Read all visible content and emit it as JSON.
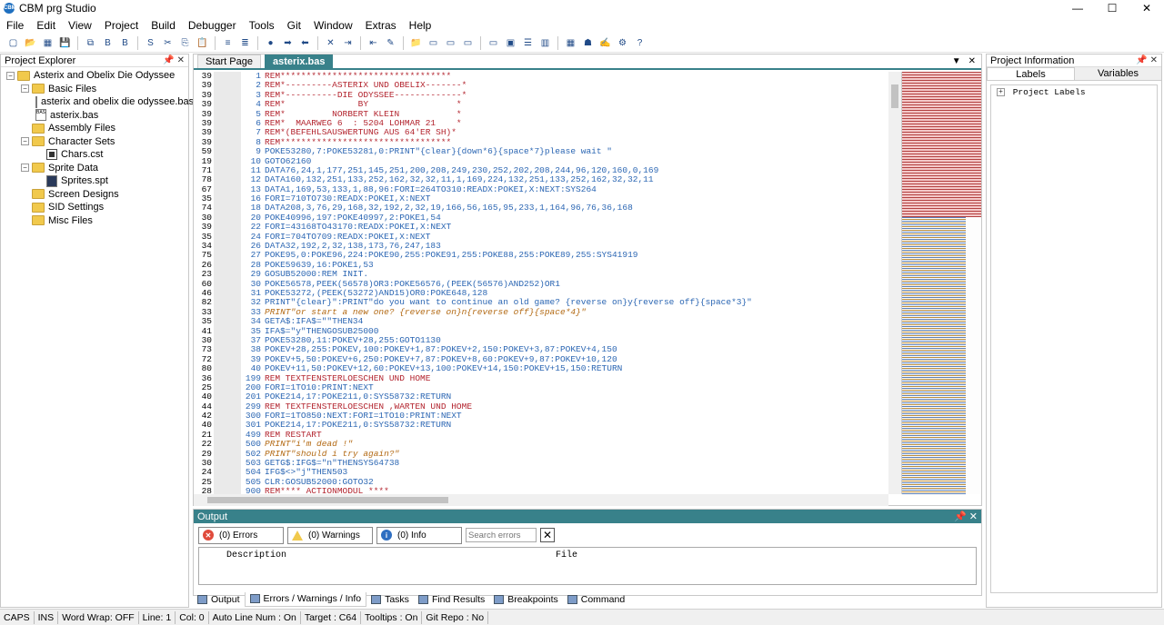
{
  "app": {
    "title": "CBM prg Studio"
  },
  "window_controls": {
    "minimize": "—",
    "maximize": "☐",
    "close": "✕"
  },
  "menu": [
    "File",
    "Edit",
    "View",
    "Project",
    "Build",
    "Debugger",
    "Tools",
    "Git",
    "Window",
    "Extras",
    "Help"
  ],
  "toolbar": {
    "icons": [
      "new-project-icon",
      "open-icon",
      "layout-icon",
      "save-icon",
      "save-all-icon",
      "build-bin-icon",
      "build-bas-icon",
      "build-seq-icon",
      "cut-icon",
      "copy-icon",
      "paste-icon",
      "comment-icon",
      "uncomment-icon",
      "breakpoint-icon",
      "step-icon",
      "back-icon",
      "stop-icon",
      "indent-icon",
      "outdent-icon",
      "edit-icon",
      "open-folder-icon",
      "prg-icon",
      "prg-run-icon",
      "pr7-icon",
      "pr7-run-icon",
      "screen-icon",
      "list-icon",
      "column-icon",
      "grid-icon",
      "robot-icon",
      "pen-icon",
      "gear-icon",
      "help-icon"
    ]
  },
  "explorer": {
    "title": "Project Explorer",
    "project_name": "Asterix and Obelix Die Odyssee",
    "nodes": [
      {
        "label": "Basic Files",
        "type": "folder",
        "level": 1,
        "expanded": true
      },
      {
        "label": "asterix and obelix die odyssee.bas",
        "type": "bas",
        "level": 2
      },
      {
        "label": "asterix.bas",
        "type": "bas",
        "level": 2
      },
      {
        "label": "Assembly Files",
        "type": "folder",
        "level": 1
      },
      {
        "label": "Character Sets",
        "type": "folder",
        "level": 1,
        "expanded": true
      },
      {
        "label": "Chars.cst",
        "type": "cst",
        "level": 2
      },
      {
        "label": "Sprite Data",
        "type": "folder",
        "level": 1,
        "expanded": true
      },
      {
        "label": "Sprites.spt",
        "type": "spt",
        "level": 2
      },
      {
        "label": "Screen Designs",
        "type": "folder",
        "level": 1
      },
      {
        "label": "SID Settings",
        "type": "folder",
        "level": 1
      },
      {
        "label": "Misc Files",
        "type": "folder",
        "level": 1
      }
    ]
  },
  "editor": {
    "tabs": [
      "Start Page",
      "asterix.bas"
    ],
    "active_tab": "asterix.bas",
    "lines": [
      {
        "n": "39",
        "ln": "1",
        "t": "REM*********************************",
        "k": "rem"
      },
      {
        "n": "39",
        "ln": "2",
        "t": "REM*---------ASTERIX UND OBELIX-------*",
        "k": "rem"
      },
      {
        "n": "39",
        "ln": "3",
        "t": "REM*----------DIE ODYSSEE-------------*",
        "k": "rem"
      },
      {
        "n": "39",
        "ln": "4",
        "t": "REM*              BY                 *",
        "k": "rem"
      },
      {
        "n": "39",
        "ln": "5",
        "t": "REM*         NORBERT KLEIN           *",
        "k": "rem"
      },
      {
        "n": "39",
        "ln": "6",
        "t": "REM*  MAARWEG 6  : 5204 LOHMAR 21    *",
        "k": "rem"
      },
      {
        "n": "39",
        "ln": "7",
        "t": "REM*(BEFEHLSAUSWERTUNG AUS 64'ER SH)*",
        "k": "rem"
      },
      {
        "n": "39",
        "ln": "8",
        "t": "REM*********************************",
        "k": "rem"
      },
      {
        "n": "59",
        "ln": "9",
        "t": "POKE53280,7:POKE53281,0:PRINT\"{clear}{down*6}{space*7}please wait \"",
        "k": "code"
      },
      {
        "n": "19",
        "ln": "10",
        "t": "GOTO62160",
        "k": "code"
      },
      {
        "n": "71",
        "ln": "11",
        "t": "DATA76,24,1,177,251,145,251,200,208,249,230,252,202,208,244,96,120,160,0,169",
        "k": "code"
      },
      {
        "n": "78",
        "ln": "12",
        "t": "DATA160,132,251,133,252,162,32,32,11,1,169,224,132,251,133,252,162,32,32,11",
        "k": "code"
      },
      {
        "n": "67",
        "ln": "13",
        "t": "DATA1,169,53,133,1,88,96:FORI=264TO310:READX:POKEI,X:NEXT:SYS264",
        "k": "code"
      },
      {
        "n": "35",
        "ln": "16",
        "t": "FORI=710TO730:READX:POKEI,X:NEXT",
        "k": "code"
      },
      {
        "n": "74",
        "ln": "18",
        "t": "DATA208,3,76,29,168,32,192,2,32,19,166,56,165,95,233,1,164,96,76,36,168",
        "k": "code"
      },
      {
        "n": "30",
        "ln": "20",
        "t": "POKE40996,197:POKE40997,2:POKE1,54",
        "k": "code"
      },
      {
        "n": "39",
        "ln": "22",
        "t": "FORI=43168TO43170:READX:POKEI,X:NEXT",
        "k": "code"
      },
      {
        "n": "35",
        "ln": "24",
        "t": "FORI=704TO709:READX:POKEI,X:NEXT",
        "k": "code"
      },
      {
        "n": "34",
        "ln": "26",
        "t": "DATA32,192,2,32,138,173,76,247,183",
        "k": "code"
      },
      {
        "n": "75",
        "ln": "27",
        "t": "POKE95,0:POKE96,224:POKE90,255:POKE91,255:POKE88,255:POKE89,255:SYS41919",
        "k": "code"
      },
      {
        "n": "26",
        "ln": "28",
        "t": "POKE59639,16:POKE1,53",
        "k": "code"
      },
      {
        "n": "23",
        "ln": "29",
        "t": "GOSUB52000:REM INIT.",
        "k": "code"
      },
      {
        "n": "60",
        "ln": "30",
        "t": "POKE56578,PEEK(56578)OR3:POKE56576,(PEEK(56576)AND252)OR1",
        "k": "code"
      },
      {
        "n": "46",
        "ln": "31",
        "t": "POKE53272,(PEEK(53272)AND15)OR0:POKE648,128",
        "k": "code"
      },
      {
        "n": "82",
        "ln": "32",
        "t": "PRINT\"{clear}\":PRINT\"do you want to continue an old game? {reverse on}y{reverse off}{space*3}\"",
        "k": "code"
      },
      {
        "n": "33",
        "ln": "33",
        "t": "PRINT\"or start a new one? {reverse on}n{reverse off}{space*4}\"",
        "k": "str"
      },
      {
        "n": "35",
        "ln": "34",
        "t": "GETA$:IFA$=\"\"THEN34",
        "k": "code"
      },
      {
        "n": "41",
        "ln": "35",
        "t": "IFA$=\"y\"THENGOSUB25000",
        "k": "code"
      },
      {
        "n": "30",
        "ln": "37",
        "t": "POKE53280,11:POKEV+28,255:GOTO1130",
        "k": "code"
      },
      {
        "n": "73",
        "ln": "38",
        "t": "POKEV+28,255:POKEV,100:POKEV+1,87:POKEV+2,150:POKEV+3,87:POKEV+4,150",
        "k": "code"
      },
      {
        "n": "72",
        "ln": "39",
        "t": "POKEV+5,50:POKEV+6,250:POKEV+7,87:POKEV+8,60:POKEV+9,87:POKEV+10,120",
        "k": "code"
      },
      {
        "n": "80",
        "ln": "40",
        "t": "POKEV+11,50:POKEV+12,60:POKEV+13,100:POKEV+14,150:POKEV+15,150:RETURN",
        "k": "code"
      },
      {
        "n": "36",
        "ln": "199",
        "t": "REM TEXTFENSTERLOESCHEN UND HOME",
        "k": "rem"
      },
      {
        "n": "25",
        "ln": "200",
        "t": "FORI=1TO10:PRINT:NEXT",
        "k": "code"
      },
      {
        "n": "40",
        "ln": "201",
        "t": "POKE214,17:POKE211,0:SYS58732:RETURN",
        "k": "code"
      },
      {
        "n": "44",
        "ln": "299",
        "t": "REM TEXTFENSTERLOESCHEN ,WARTEN UND HOME",
        "k": "rem"
      },
      {
        "n": "42",
        "ln": "300",
        "t": "FORI=1TO850:NEXT:FORI=1TO10:PRINT:NEXT",
        "k": "code"
      },
      {
        "n": "40",
        "ln": "301",
        "t": "POKE214,17:POKE211,0:SYS58732:RETURN",
        "k": "code"
      },
      {
        "n": "21",
        "ln": "499",
        "t": "REM RESTART",
        "k": "rem"
      },
      {
        "n": "22",
        "ln": "500",
        "t": "PRINT\"i'm dead !\"",
        "k": "str"
      },
      {
        "n": "29",
        "ln": "502",
        "t": "PRINT\"should i try again?\"",
        "k": "str"
      },
      {
        "n": "30",
        "ln": "503",
        "t": "GETG$:IFG$=\"n\"THENSYS64738",
        "k": "code"
      },
      {
        "n": "24",
        "ln": "504",
        "t": "IFG$<>\"j\"THEN503",
        "k": "code"
      },
      {
        "n": "25",
        "ln": "505",
        "t": "CLR:GOSUB52000:GOTO32",
        "k": "code"
      },
      {
        "n": "28",
        "ln": "900",
        "t": "REM**** ACTIONMODUL ****",
        "k": "rem"
      }
    ]
  },
  "output": {
    "title": "Output",
    "errors_label": "(0) Errors",
    "warnings_label": "(0) Warnings",
    "info_label": "(0) Info",
    "search_placeholder": "Search errors",
    "col_description": "Description",
    "col_file": "File",
    "tabs": [
      "Output",
      "Errors / Warnings / Info",
      "Tasks",
      "Find Results",
      "Breakpoints",
      "Command"
    ],
    "active_tab": "Errors / Warnings / Info"
  },
  "project_info": {
    "title": "Project Information",
    "tabs": [
      "Labels",
      "Variables"
    ],
    "active_tab": "Labels",
    "tree_root": "Project Labels"
  },
  "statusbar": [
    "CAPS",
    "INS",
    "Word Wrap: OFF",
    "Line: 1",
    "Col: 0",
    "Auto Line Num : On",
    "Target : C64",
    "Tooltips : On",
    "Git Repo : No"
  ]
}
